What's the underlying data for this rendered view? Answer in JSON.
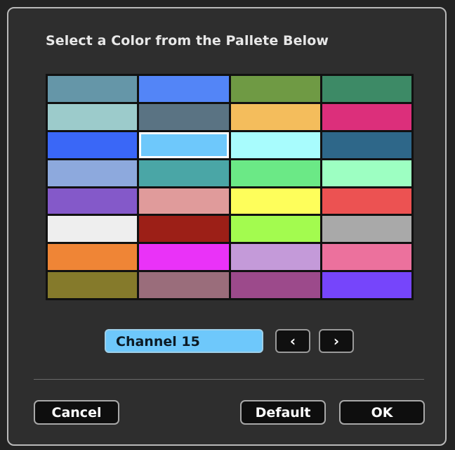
{
  "dialog": {
    "title": "Select a Color from the Pallete Below",
    "swatches": [
      "#6596a8",
      "#5385f7",
      "#6f9a44",
      "#3d8a66",
      "#9ccbcb",
      "#5a7383",
      "#f4bd5c",
      "#dc2f7b",
      "#3a67f7",
      "#6ec8fb",
      "#a8fcfd",
      "#2e6789",
      "#8da9dd",
      "#4aa6a6",
      "#6be986",
      "#9dffc2",
      "#8459c9",
      "#e09b9b",
      "#fefe5b",
      "#ec5252",
      "#eeeeee",
      "#9c1f17",
      "#a3fb4f",
      "#a9a9a9",
      "#ef8536",
      "#ea32f8",
      "#c49ad9",
      "#ec719d",
      "#857a2b",
      "#9a6d7b",
      "#9c4a8b",
      "#7645fb"
    ],
    "selected_index": 9,
    "channel_label": "Channel 15",
    "channel_color": "#6ec8fb",
    "prev_label": "‹",
    "next_label": "›",
    "cancel_label": "Cancel",
    "default_label": "Default",
    "ok_label": "OK"
  }
}
